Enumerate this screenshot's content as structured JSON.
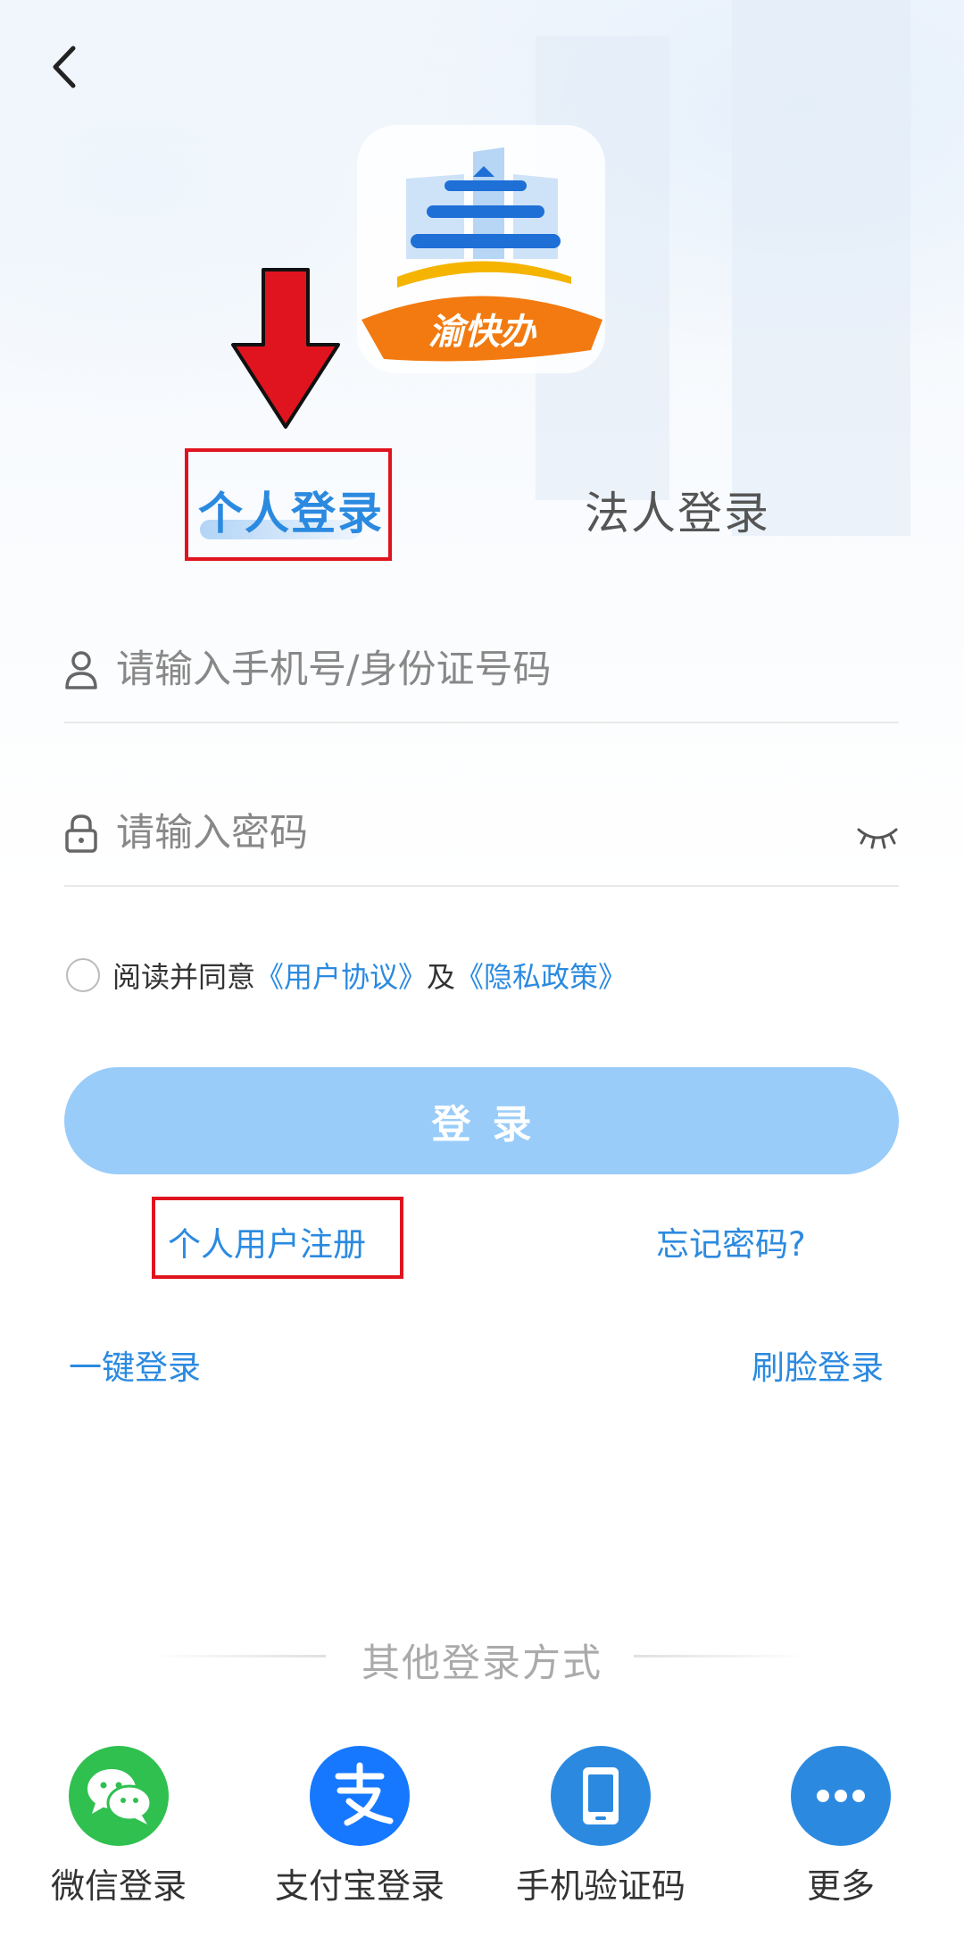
{
  "logo": {
    "text": "渝快办"
  },
  "tabs": {
    "personal": "个人登录",
    "corporate": "法人登录"
  },
  "account": {
    "placeholder": "请输入手机号/身份证号码"
  },
  "password": {
    "placeholder": "请输入密码"
  },
  "agreement": {
    "prefix": "阅读并同意",
    "user_agreement": "《用户协议》",
    "and": "及",
    "privacy_policy": "《隐私政策》"
  },
  "login_button": "登录",
  "links": {
    "register": "个人用户注册",
    "forgot": "忘记密码?",
    "one_click": "一键登录",
    "face": "刷脸登录"
  },
  "other": {
    "title": "其他登录方式",
    "methods": [
      {
        "label": "微信登录",
        "icon": "wechat-icon",
        "color": "#2fc04f"
      },
      {
        "label": "支付宝登录",
        "icon": "alipay-icon",
        "color": "#1678ff"
      },
      {
        "label": "手机验证码",
        "icon": "phone-icon",
        "color": "#2b8ae0"
      },
      {
        "label": "更多",
        "icon": "more-icon",
        "color": "#2b8ae0"
      }
    ]
  },
  "colors": {
    "accent": "#2b8ae0",
    "button": "#99ccf9",
    "highlight_box": "#e0141e"
  }
}
